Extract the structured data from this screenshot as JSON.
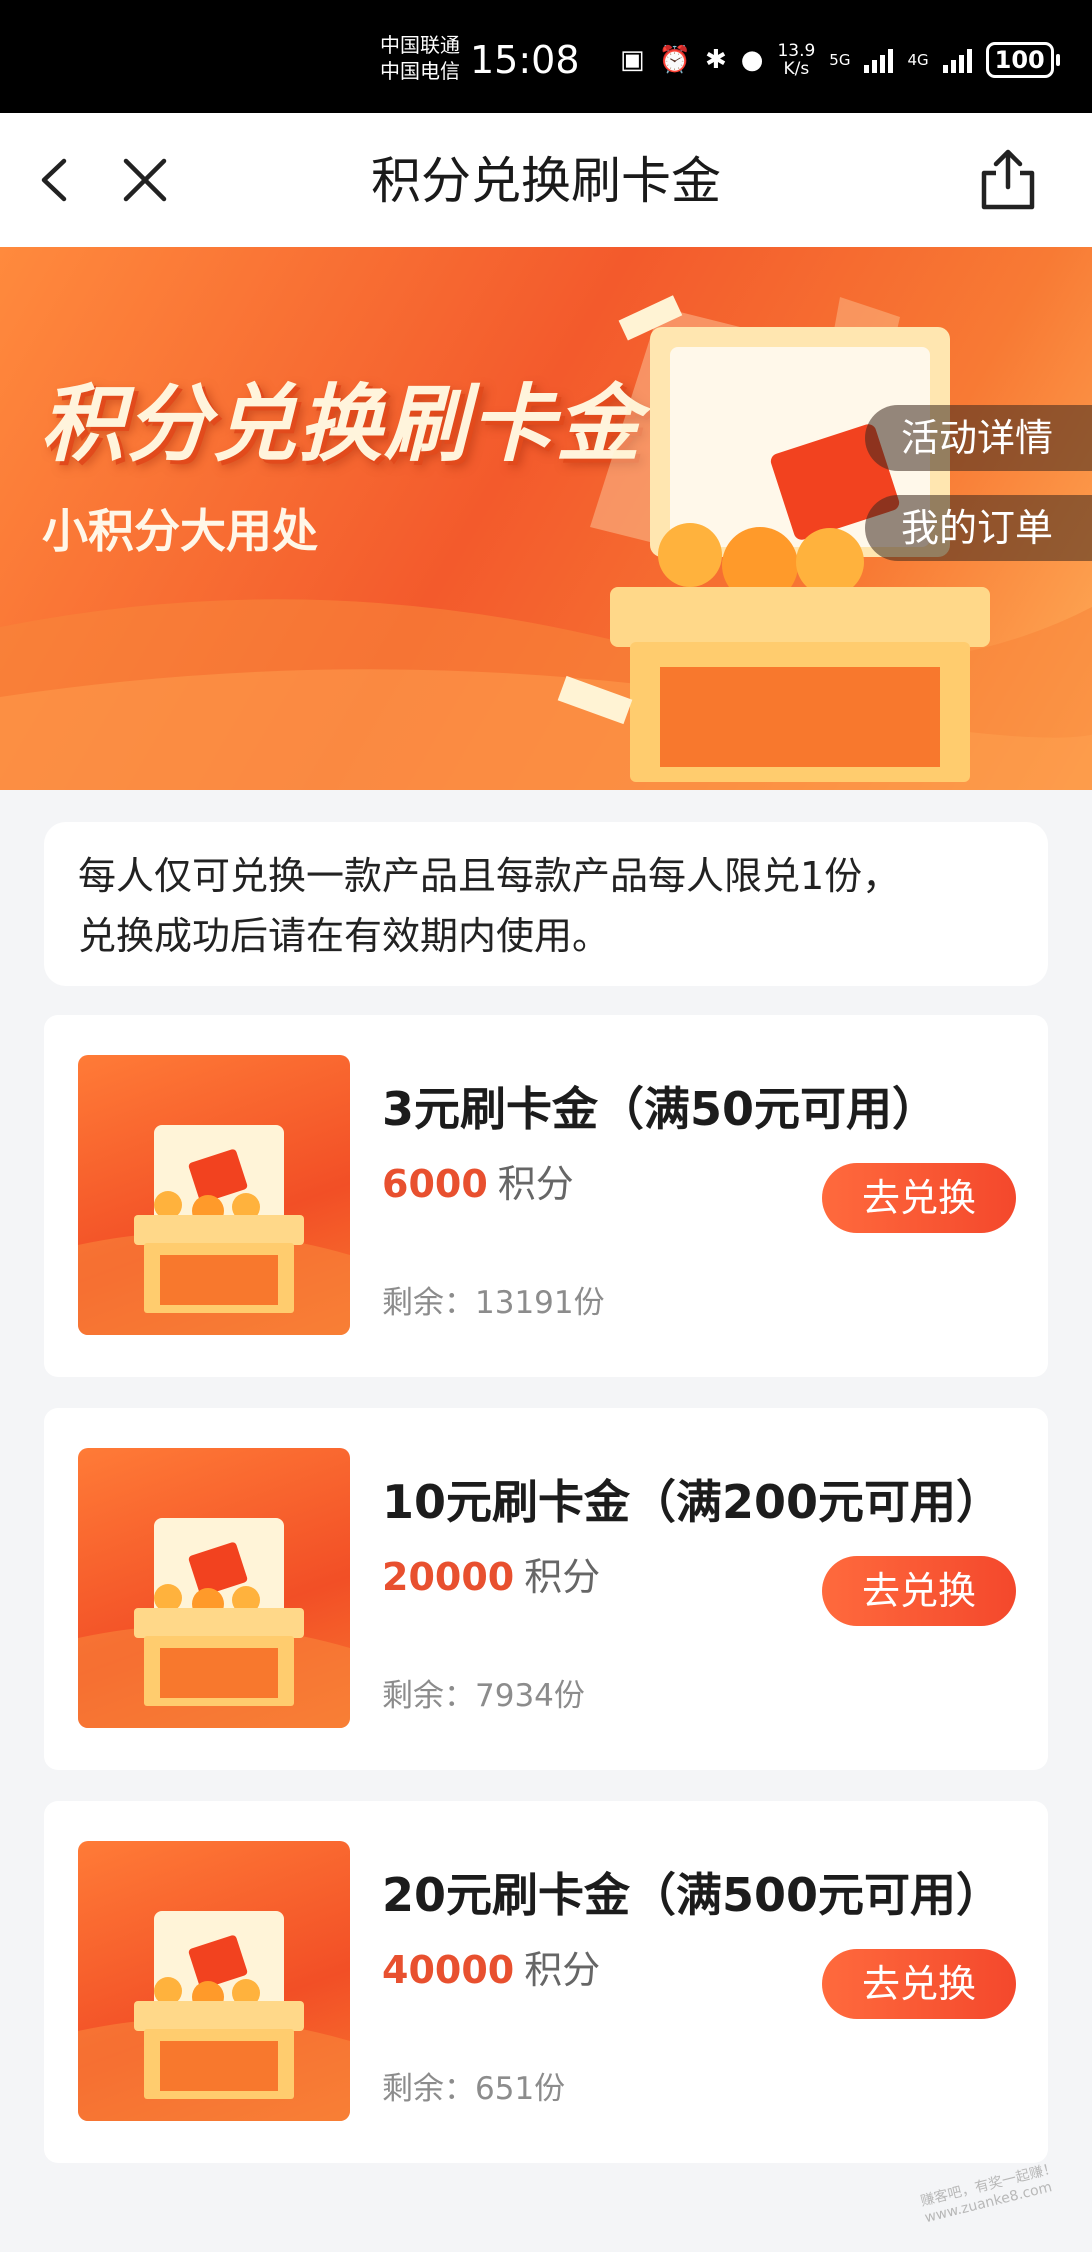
{
  "status_bar": {
    "carrier_1": "中国联通",
    "carrier_2": "中国电信",
    "time": "15:08",
    "net_speed_value": "13.9",
    "net_speed_unit": "K/s",
    "network_1": "5G",
    "network_2": "4G",
    "battery": "100"
  },
  "nav": {
    "title": "积分兑换刷卡金"
  },
  "banner": {
    "title": "积分兑换刷卡金",
    "subtitle": "小积分大用处",
    "detail_button": "活动详情",
    "orders_button": "我的订单"
  },
  "notice": {
    "line_1": "每人仅可兑换一款产品且每款产品每人限兑1份，",
    "line_2": "兑换成功后请在有效期内使用。"
  },
  "products": [
    {
      "name": "3元刷卡金（满50元可用）",
      "points": "6000",
      "points_unit": "积分",
      "stock": "剩余：13191份",
      "button": "去兑换"
    },
    {
      "name": "10元刷卡金（满200元可用）",
      "points": "20000",
      "points_unit": "积分",
      "stock": "剩余：7934份",
      "button": "去兑换"
    },
    {
      "name": "20元刷卡金（满500元可用）",
      "points": "40000",
      "points_unit": "积分",
      "stock": "剩余：651份",
      "button": "去兑换"
    }
  ],
  "watermark": "赚客吧，有奖一起赚！ www.zuanke8.com",
  "colors": {
    "accent": "#f4482c",
    "points": "#e8502f",
    "banner_start": "#ff8a3d",
    "banner_end": "#f35a2c"
  }
}
